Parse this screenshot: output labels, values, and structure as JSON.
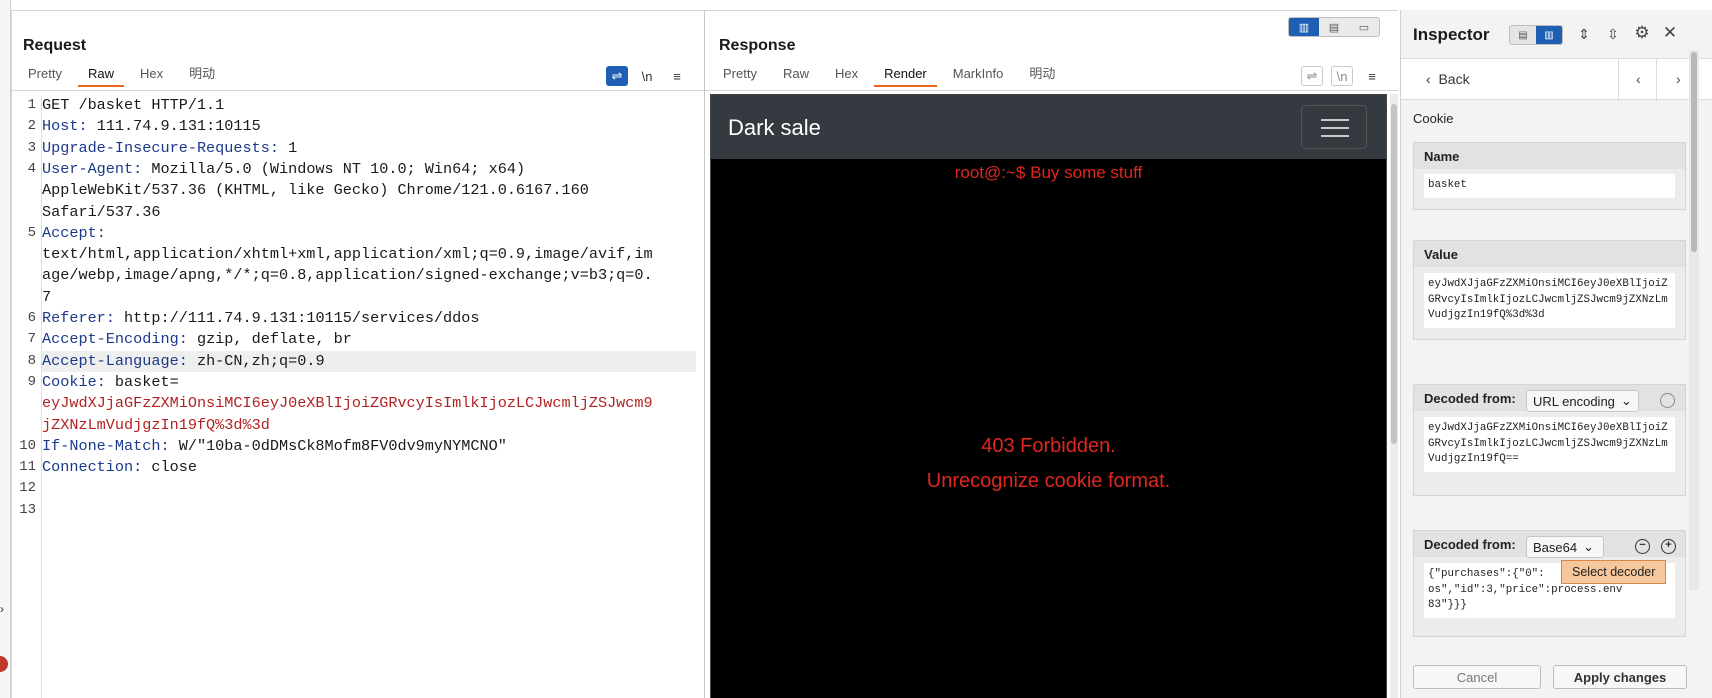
{
  "request": {
    "title": "Request",
    "tabs": [
      "Pretty",
      "Raw",
      "Hex",
      "明动"
    ],
    "active_tab": "Raw",
    "toolbar": {
      "wrap": "⇌",
      "newline": "\\n",
      "menu": "≡"
    },
    "lines": [
      {
        "n": "1",
        "text": "GET /basket HTTP/1.1"
      },
      {
        "n": "2",
        "key": "Host",
        "value": " 111.74.9.131:10115"
      },
      {
        "n": "3",
        "key": "Upgrade-Insecure-Requests",
        "value": " 1"
      },
      {
        "n": "4",
        "key": "User-Agent",
        "value": " Mozilla/5.0 (Windows NT 10.0; Win64; x64)"
      },
      {
        "n": "",
        "text": "AppleWebKit/537.36 (KHTML, like Gecko) Chrome/121.0.6167.160"
      },
      {
        "n": "",
        "text": "Safari/537.36"
      },
      {
        "n": "5",
        "key": "Accept",
        "value": ""
      },
      {
        "n": "",
        "text": "text/html,application/xhtml+xml,application/xml;q=0.9,image/avif,im"
      },
      {
        "n": "",
        "text": "age/webp,image/apng,*/*;q=0.8,application/signed-exchange;v=b3;q=0."
      },
      {
        "n": "",
        "text": "7"
      },
      {
        "n": "6",
        "key": "Referer",
        "value": " http://111.74.9.131:10115/services/ddos"
      },
      {
        "n": "7",
        "key": "Accept-Encoding",
        "value": " gzip, deflate, br"
      },
      {
        "n": "8",
        "key": "Accept-Language",
        "value": " zh-CN,zh;q=0.9"
      },
      {
        "n": "9",
        "key": "Cookie",
        "value": " basket="
      },
      {
        "n": "",
        "cookie": "eyJwdXJjaGFzZXMiOnsiMCI6eyJ0eXBlIjoiZGRvcyIsImlkIjozLCJwcmljZSJwcm9"
      },
      {
        "n": "",
        "cookie": "jZXNzLmVudjgzIn19fQ%3d%3d"
      },
      {
        "n": "10",
        "key": "If-None-Match",
        "value": " W/\"10ba-0dDMsCk8Mofm8FV0dv9myNYMCNO\""
      },
      {
        "n": "11",
        "key": "Connection",
        "value": " close"
      },
      {
        "n": "12",
        "text": ""
      },
      {
        "n": "13",
        "text": ""
      }
    ]
  },
  "response": {
    "title": "Response",
    "tabs": [
      "Pretty",
      "Raw",
      "Hex",
      "Render",
      "MarkInfo",
      "明动"
    ],
    "active_tab": "Render",
    "toolbar": {
      "wrap": "⇌",
      "newline": "\\n",
      "menu": "≡"
    },
    "render": {
      "brand": "Dark sale",
      "prompt": "root@:~$ Buy some stuff",
      "error_line1": "403 Forbidden.",
      "error_line2": "Unrecognize cookie format."
    }
  },
  "inspector": {
    "title": "Inspector",
    "back_label": "Back",
    "section": "Cookie",
    "name_label": "Name",
    "name_value": "basket",
    "value_label": "Value",
    "value_text": "eyJwdXJjaGFzZXMiOnsiMCI6eyJ0eXBlIjoiZGRvcyIsImlkIjozLCJwcmljZSJwcm9jZXNzLmVudjgzIn19fQ%3d%3d",
    "decoded1_label": "Decoded from:",
    "decoded1_select": "URL encoding",
    "decoded1_text": "eyJwdXJjaGFzZXMiOnsiMCI6eyJ0eXBlIjoiZGRvcyIsImlkIjozLCJwcmljZSJwcm9jZXNzLmVudjgzIn19fQ==",
    "decoded2_label": "Decoded from:",
    "decoded2_select": "Base64",
    "decoded2_line1": "{\"purchases\":{\"0\":",
    "decoded2_line2": "os\",\"id\":3,\"price\":",
    "decoded2_line2b": "process.env",
    "decoded2_line3": "83\"}}}",
    "tooltip": "Select decoder",
    "cancel_label": "Cancel",
    "apply_label": "Apply changes"
  },
  "colors": {
    "accent_tab": "#e8671f",
    "toggle_blue": "#1e5fb3",
    "header_key": "#1c3a8c",
    "cookie_value": "#b22222",
    "render_error": "#e0261f",
    "navbar": "#343a40"
  }
}
